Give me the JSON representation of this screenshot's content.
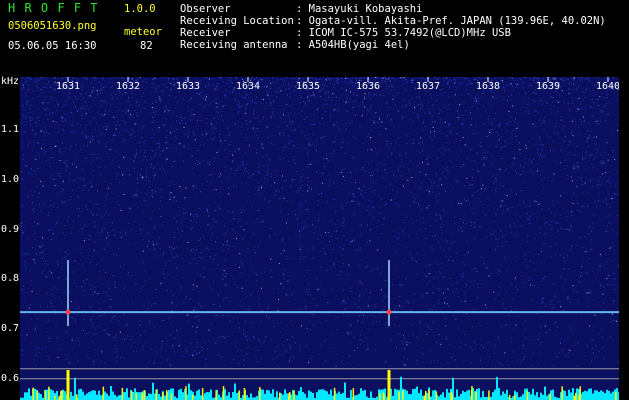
{
  "header": {
    "app_name": "H R O F F T",
    "version": "1.0.0",
    "filename": "0506051630.png",
    "datetime": "05.06.05 16:30",
    "meteor_label": "meteor",
    "meteor_count": "82"
  },
  "info": {
    "rows": [
      {
        "label": "Observer",
        "value": ": Masayuki Kobayashi"
      },
      {
        "label": "Receiving Location",
        "value": ": Ogata-vill. Akita-Pref. JAPAN (139.96E, 40.02N)"
      },
      {
        "label": "Receiver",
        "value": ": ICOM IC-575 53.7492(@LCD)MHz USB"
      },
      {
        "label": "Receiving antenna",
        "value": ": A504HB(yagi 4el)"
      }
    ]
  },
  "chart_data": {
    "type": "heatmap",
    "ylabel": "kHz",
    "x_ticks": [
      "1631",
      "1632",
      "1633",
      "1634",
      "1635",
      "1636",
      "1637",
      "1638",
      "1639",
      "1640"
    ],
    "y_ticks": [
      "1.1",
      "1.0",
      "0.9",
      "0.8",
      "0.7",
      "0.6"
    ],
    "ylim": [
      0.58,
      1.2
    ],
    "carrier_khz": 0.734,
    "meteor_echoes_minute": [
      1631.0,
      1636.35
    ],
    "colors": {
      "background": "#0a0f60",
      "carrier": "#6fc8ff",
      "histogram": "#00e8ff",
      "peaks": "#ffff00"
    }
  }
}
